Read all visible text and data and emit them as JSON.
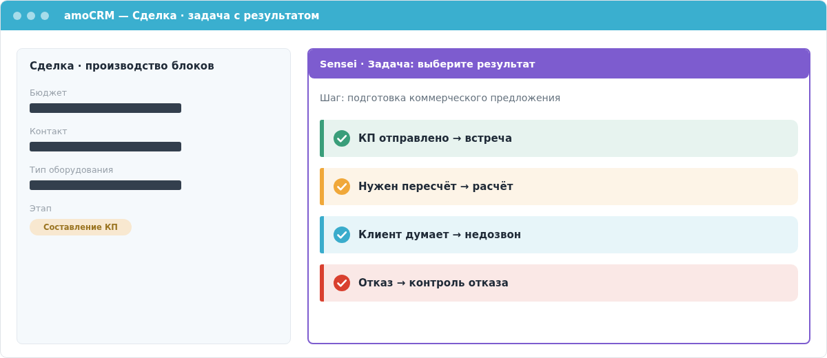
{
  "window": {
    "title": "amoCRM — Сделка · задача с результатом"
  },
  "deal": {
    "title": "Сделка · производство блоков",
    "fields": [
      {
        "label": "Бюджет",
        "kind": "redacted"
      },
      {
        "label": "Контакт",
        "kind": "redacted"
      },
      {
        "label": "Тип оборудования",
        "kind": "redacted"
      },
      {
        "label": "Этап",
        "kind": "badge",
        "value": "Составление КП"
      }
    ]
  },
  "task": {
    "title": "Sensei · Задача: выберите результат",
    "step": "Шаг: подготовка коммерческого предложения",
    "options": [
      {
        "label": "КП отправлено → встреча",
        "color": "#3a9e7a"
      },
      {
        "label": "Нужен пересчёт → расчёт",
        "color": "#f0a83a"
      },
      {
        "label": "Клиент думает → недозвон",
        "color": "#3aaccc"
      },
      {
        "label": "Отказ → контроль отказа",
        "color": "#d9402f"
      }
    ]
  }
}
